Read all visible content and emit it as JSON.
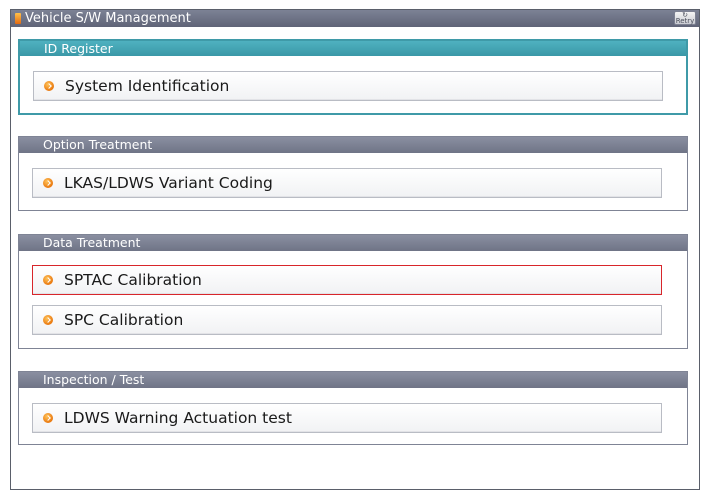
{
  "window": {
    "title": "Vehicle S/W Management",
    "retry_label": "Retry"
  },
  "groups": [
    {
      "title": "ID Register",
      "items": [
        {
          "label": "System Identification",
          "selected": false
        }
      ]
    },
    {
      "title": "Option Treatment",
      "items": [
        {
          "label": "LKAS/LDWS Variant Coding",
          "selected": false
        }
      ]
    },
    {
      "title": "Data Treatment",
      "items": [
        {
          "label": "SPTAC Calibration",
          "selected": true
        },
        {
          "label": "SPC Calibration",
          "selected": false
        }
      ]
    },
    {
      "title": "Inspection / Test",
      "items": [
        {
          "label": "LDWS Warning Actuation test",
          "selected": false
        }
      ]
    }
  ],
  "colors": {
    "titlebar": "#6b7083",
    "group_header_active": "#3f9aa8",
    "group_header": "#7f8495",
    "selected_border": "#d8262b",
    "bullet": "#e9780e"
  },
  "icons": {
    "title": "app-icon",
    "retry": "retry-icon",
    "bullet": "arrow-bullet-icon"
  }
}
